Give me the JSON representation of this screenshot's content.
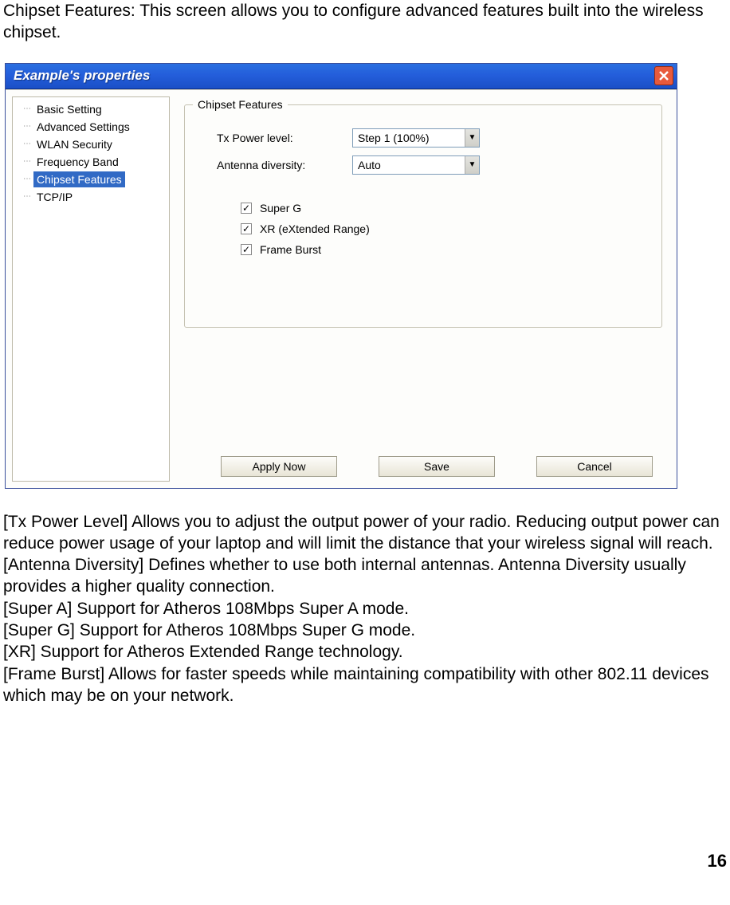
{
  "intro": "Chipset Features: This screen allows you to configure advanced features built into the wireless chipset.",
  "window": {
    "title": "Example's properties",
    "tree": {
      "items": [
        {
          "label": "Basic Setting",
          "selected": false
        },
        {
          "label": "Advanced Settings",
          "selected": false
        },
        {
          "label": "WLAN Security",
          "selected": false
        },
        {
          "label": "Frequency Band",
          "selected": false
        },
        {
          "label": "Chipset Features",
          "selected": true
        },
        {
          "label": "TCP/IP",
          "selected": false
        }
      ]
    },
    "group": {
      "title": "Chipset Features",
      "tx_label": "Tx Power level:",
      "tx_value": "Step 1 (100%)",
      "ant_label": "Antenna diversity:",
      "ant_value": "Auto",
      "checks": [
        {
          "label": "Super G",
          "checked": true
        },
        {
          "label": "XR (eXtended Range)",
          "checked": true
        },
        {
          "label": "Frame Burst",
          "checked": true
        }
      ]
    },
    "buttons": {
      "apply": "Apply Now",
      "save": "Save",
      "cancel": "Cancel"
    }
  },
  "desc": {
    "lines": [
      "[Tx Power Level] Allows you to adjust the output power of your radio. Reducing output power can reduce power usage of your laptop and will limit the distance that your wireless signal will reach.",
      "[Antenna Diversity] Defines whether to use both internal antennas. Antenna Diversity usually provides a higher quality connection.",
      "[Super A] Support for Atheros 108Mbps Super A mode.",
      "[Super G] Support for Atheros 108Mbps Super G mode.",
      "[XR] Support for Atheros Extended Range technology.",
      "[Frame Burst] Allows for faster speeds while maintaining compatibility with other 802.11 devices which may be on your network."
    ]
  },
  "page_number": "16"
}
